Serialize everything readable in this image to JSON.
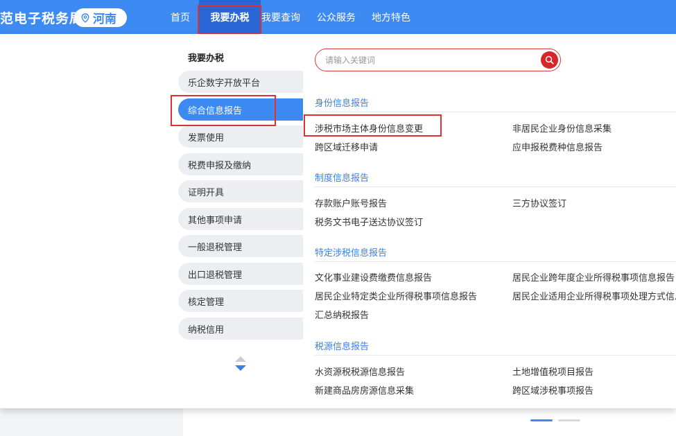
{
  "header": {
    "brand": "范电子税务局",
    "region": "河南",
    "nav": [
      "首页",
      "我要办税",
      "我要查询",
      "公众服务",
      "地方特色"
    ]
  },
  "sidebar": {
    "title": "我要办税",
    "items": [
      "乐企数字开放平台",
      "综合信息报告",
      "发票使用",
      "税费申报及缴纳",
      "证明开具",
      "其他事项申请",
      "一般退税管理",
      "出口退税管理",
      "核定管理",
      "纳税信用"
    ],
    "active_index": 1
  },
  "search": {
    "placeholder": "请输入关键词",
    "value": ""
  },
  "sections": [
    {
      "title": "身份信息报告",
      "links": [
        "涉税市场主体身份信息变更",
        "非居民企业身份信息采集",
        "跨区域迁移申请",
        "应申报税费种信息报告"
      ]
    },
    {
      "title": "制度信息报告",
      "links": [
        "存款账户账号报告",
        "三方协议签订",
        "税务文书电子送达协议签订"
      ]
    },
    {
      "title": "特定涉税信息报告",
      "links": [
        "文化事业建设费缴费信息报告",
        "居民企业跨年度企业所得税事项信息报告",
        "居民企业特定类企业所得税事项信息报告",
        "居民企业适用企业所得税事项处理方式信息",
        "汇总纳税报告"
      ]
    },
    {
      "title": "税源信息报告",
      "links": [
        "水资源税税源信息报告",
        "土地增值税项目报告",
        "新建商品房房源信息采集",
        "跨区域涉税事项报告"
      ]
    }
  ],
  "colors": {
    "header_bg": "#3d8af2",
    "nav_active_bg": "#2b66d6",
    "accent": "#3d8af2",
    "search_border": "#d23b3b",
    "search_button": "#d5262b",
    "highlight": "#e0302f"
  }
}
